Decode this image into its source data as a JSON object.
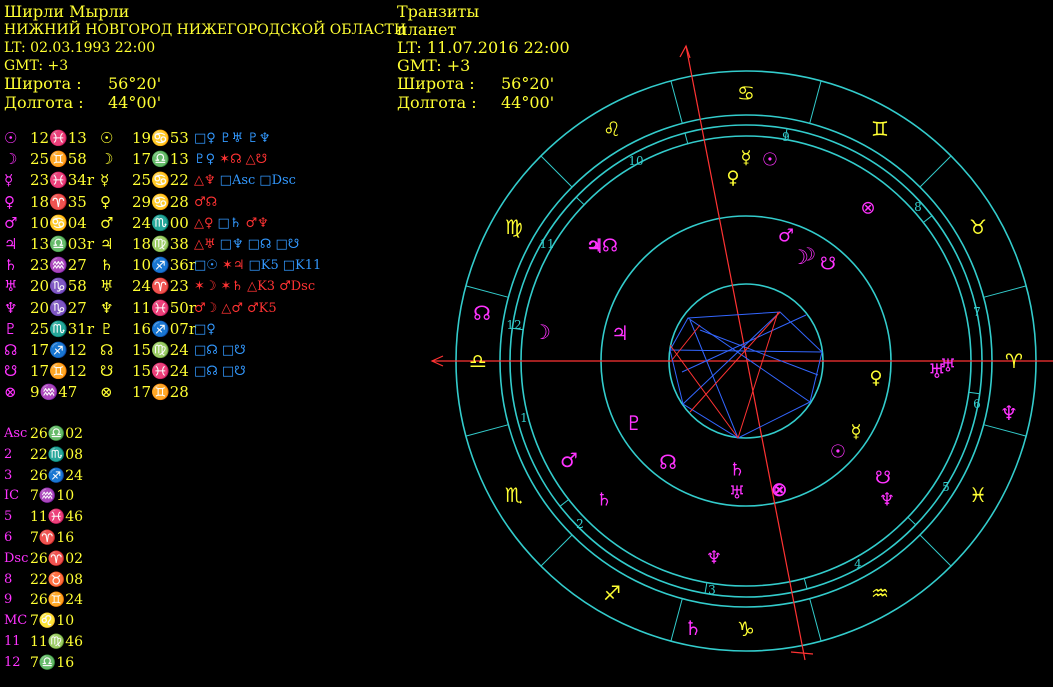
{
  "natal_header": {
    "name": "Ширли Мырли",
    "place": "НИЖНИЙ НОВГОРОД НИЖЕГОРОДСКОЙ ОБЛАСТИ",
    "lt": "LT: 02.03.1993  22:00",
    "gmt": "GMT: +3",
    "lat_label": "Широта :",
    "lat_value": "56°20'",
    "lon_label": "Долгота :",
    "lon_value": "44°00'"
  },
  "transit_header": {
    "title": "Транзиты",
    "subtitle": "планет",
    "lt": "LT: 11.07.2016  22:00",
    "gmt": "GMT: +3",
    "lat_label": "Широта :",
    "lat_value": "56°20'",
    "lon_label": "Долгота :",
    "lon_value": "44°00'"
  },
  "planet_table": [
    {
      "glyph": "☉",
      "natal": "12♓13",
      "tglyph": "☉",
      "transit": "19♋53",
      "aspects": [
        [
          "□♀",
          "blue"
        ],
        [
          "♇♅ ♇♆",
          "blue"
        ]
      ]
    },
    {
      "glyph": "☽",
      "natal": "25♊58",
      "tglyph": "☽",
      "transit": "17♎13",
      "aspects": [
        [
          "♇♀",
          "blue"
        ],
        [
          "✶☊",
          "red"
        ],
        [
          "△☋",
          "red"
        ]
      ]
    },
    {
      "glyph": "☿",
      "natal": "23♓34r",
      "tglyph": "☿",
      "transit": "25♋22",
      "aspects": [
        [
          "△♆",
          "red"
        ],
        [
          "□Asc",
          "blue"
        ],
        [
          "□Dsc",
          "blue"
        ]
      ]
    },
    {
      "glyph": "♀",
      "natal": "18♈35",
      "tglyph": "♀",
      "transit": "29♋28",
      "aspects": [
        [
          "♂☊",
          "red"
        ]
      ]
    },
    {
      "glyph": "♂",
      "natal": "10♋04",
      "tglyph": "♂",
      "transit": "24♏00",
      "aspects": [
        [
          "△♀",
          "red"
        ],
        [
          "□♄",
          "blue"
        ],
        [
          "♂♆",
          "red"
        ]
      ]
    },
    {
      "glyph": "♃",
      "natal": "13♎03r",
      "tglyph": "♃",
      "transit": "18♍38",
      "aspects": [
        [
          "△♅",
          "red"
        ],
        [
          "□♆",
          "blue"
        ],
        [
          "□☊",
          "blue"
        ],
        [
          "□☋",
          "blue"
        ]
      ]
    },
    {
      "glyph": "♄",
      "natal": "23♒27",
      "tglyph": "♄",
      "transit": "10♐36r",
      "aspects": [
        [
          "□☉",
          "blue"
        ],
        [
          "✶♃",
          "red"
        ],
        [
          "□K5",
          "blue"
        ],
        [
          "□K11",
          "blue"
        ]
      ]
    },
    {
      "glyph": "♅",
      "natal": "20♑58",
      "tglyph": "♅",
      "transit": "24♈23",
      "aspects": [
        [
          "✶☽",
          "red"
        ],
        [
          "✶♄",
          "red"
        ],
        [
          "△K3",
          "red"
        ],
        [
          "♂Dsc",
          "red"
        ]
      ]
    },
    {
      "glyph": "♆",
      "natal": "20♑27",
      "tglyph": "♆",
      "transit": "11♓50r",
      "aspects": [
        [
          "♂☽",
          "red"
        ],
        [
          "△♂",
          "red"
        ],
        [
          "♂K5",
          "red"
        ]
      ]
    },
    {
      "glyph": "♇",
      "natal": "25♏31r",
      "tglyph": "♇",
      "transit": "16♐07r",
      "aspects": [
        [
          "□♀",
          "blue"
        ]
      ]
    },
    {
      "glyph": "☊",
      "natal": "17♐12",
      "tglyph": "☊",
      "transit": "15♍24",
      "aspects": [
        [
          "□☊",
          "blue"
        ],
        [
          "□☋",
          "blue"
        ]
      ]
    },
    {
      "glyph": "☋",
      "natal": "17♊12",
      "tglyph": "☋",
      "transit": "15♓24",
      "aspects": [
        [
          "□☊",
          "blue"
        ],
        [
          "□☋",
          "blue"
        ]
      ]
    },
    {
      "glyph": "⊗",
      "natal": "9♒47",
      "tglyph": "⊗",
      "transit": "17♊28",
      "aspects": []
    }
  ],
  "house_cusps": [
    {
      "label": "Asc",
      "value": "26♎02"
    },
    {
      "label": "2",
      "value": "22♏08"
    },
    {
      "label": "3",
      "value": "26♐24"
    },
    {
      "label": "IC",
      "value": "7♒10"
    },
    {
      "label": "5",
      "value": "11♓46"
    },
    {
      "label": "6",
      "value": "7♈16"
    },
    {
      "label": "Dsc",
      "value": "26♈02"
    },
    {
      "label": "8",
      "value": "22♉08"
    },
    {
      "label": "9",
      "value": "26♊24"
    },
    {
      "label": "MC",
      "value": "7♌10"
    },
    {
      "label": "11",
      "value": "11♍46"
    },
    {
      "label": "12",
      "value": "7♎16"
    }
  ],
  "wheel": {
    "colors": {
      "ring": "#33cccc",
      "sign": "#ffff33",
      "natal": "#ff33ff",
      "transit": "#ffff33",
      "axis": "#ff3333",
      "house": "#33cccc"
    },
    "house_numbers": [
      "1",
      "2",
      "3",
      "4",
      "5",
      "6",
      "7",
      "8",
      "9",
      "10",
      "11",
      "12"
    ],
    "sign_glyphs": [
      "♌",
      "♋",
      "♊",
      "♉",
      "♈",
      "♓",
      "♒",
      "♑",
      "♐",
      "♏",
      "♎",
      "♍"
    ],
    "transit_glyphs": [
      "☿",
      "☉",
      "♀",
      "⊗",
      "♂",
      "☽",
      "☋",
      "♅",
      "♀",
      "☿",
      "☉",
      "☋",
      "♆",
      "⊗",
      "♄",
      "♆",
      "♅",
      "♄",
      "♃",
      "☊"
    ],
    "natal_glyphs": [
      "♃",
      "☊",
      "☽",
      "♃",
      "♇",
      "♂",
      "☊",
      "♆",
      "♅",
      "♄",
      "⊗",
      "☽"
    ]
  }
}
